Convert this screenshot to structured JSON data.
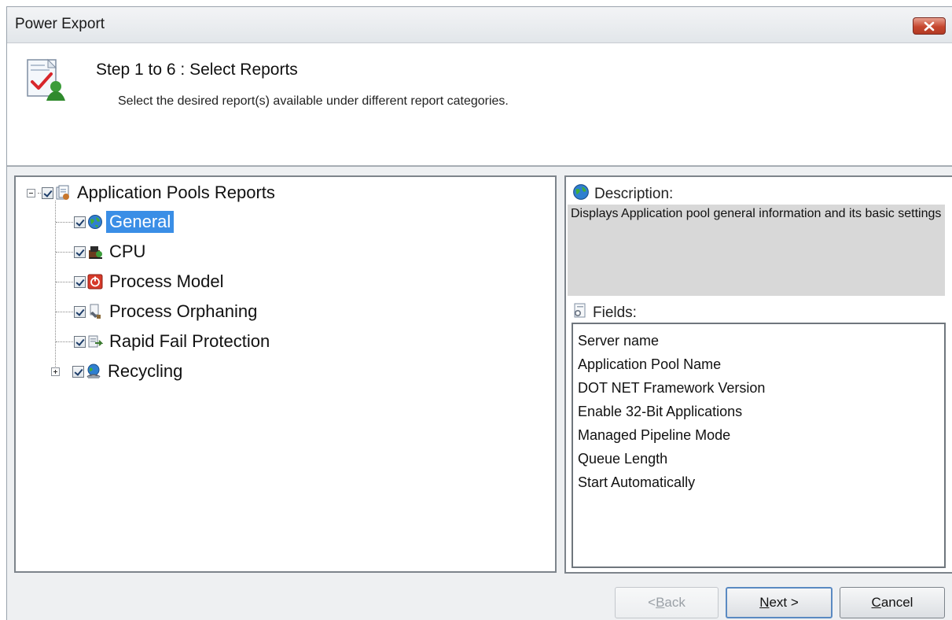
{
  "window": {
    "title": "Power Export"
  },
  "header": {
    "step_title": "Step 1 to 6 : Select Reports",
    "step_description": "Select the desired report(s) available under different report categories."
  },
  "tree": {
    "root": {
      "label": "Application Pools Reports",
      "checked": true,
      "expanded": true
    },
    "items": [
      {
        "label": "General",
        "checked": true,
        "selected": true,
        "icon": "globe-icon"
      },
      {
        "label": "CPU",
        "checked": true,
        "icon": "cpu-icon"
      },
      {
        "label": "Process Model",
        "checked": true,
        "icon": "power-icon"
      },
      {
        "label": "Process Orphaning",
        "checked": true,
        "icon": "process-orphaning-icon"
      },
      {
        "label": "Rapid Fail Protection",
        "checked": true,
        "icon": "rapid-fail-icon"
      },
      {
        "label": "Recycling",
        "checked": true,
        "icon": "recycle-icon",
        "expandable": true
      }
    ]
  },
  "details": {
    "description_label": "Description:",
    "description_text": "Displays Application pool general information and its basic settings",
    "fields_label": "Fields:",
    "fields": [
      "Server name",
      "Application Pool Name",
      "DOT NET Framework Version",
      "Enable 32-Bit Applications",
      "Managed Pipeline Mode",
      "Queue Length",
      "Start Automatically"
    ]
  },
  "buttons": {
    "back": {
      "prefix": "<",
      "accel": "B",
      "rest": "ack",
      "enabled": false
    },
    "next": {
      "accel": "N",
      "rest": "ext >"
    },
    "cancel": {
      "accel": "C",
      "rest": "ancel"
    }
  },
  "colors": {
    "selection": "#3a8ee6",
    "close_button": "#c6472f",
    "description_bg": "#d8d8d8"
  }
}
